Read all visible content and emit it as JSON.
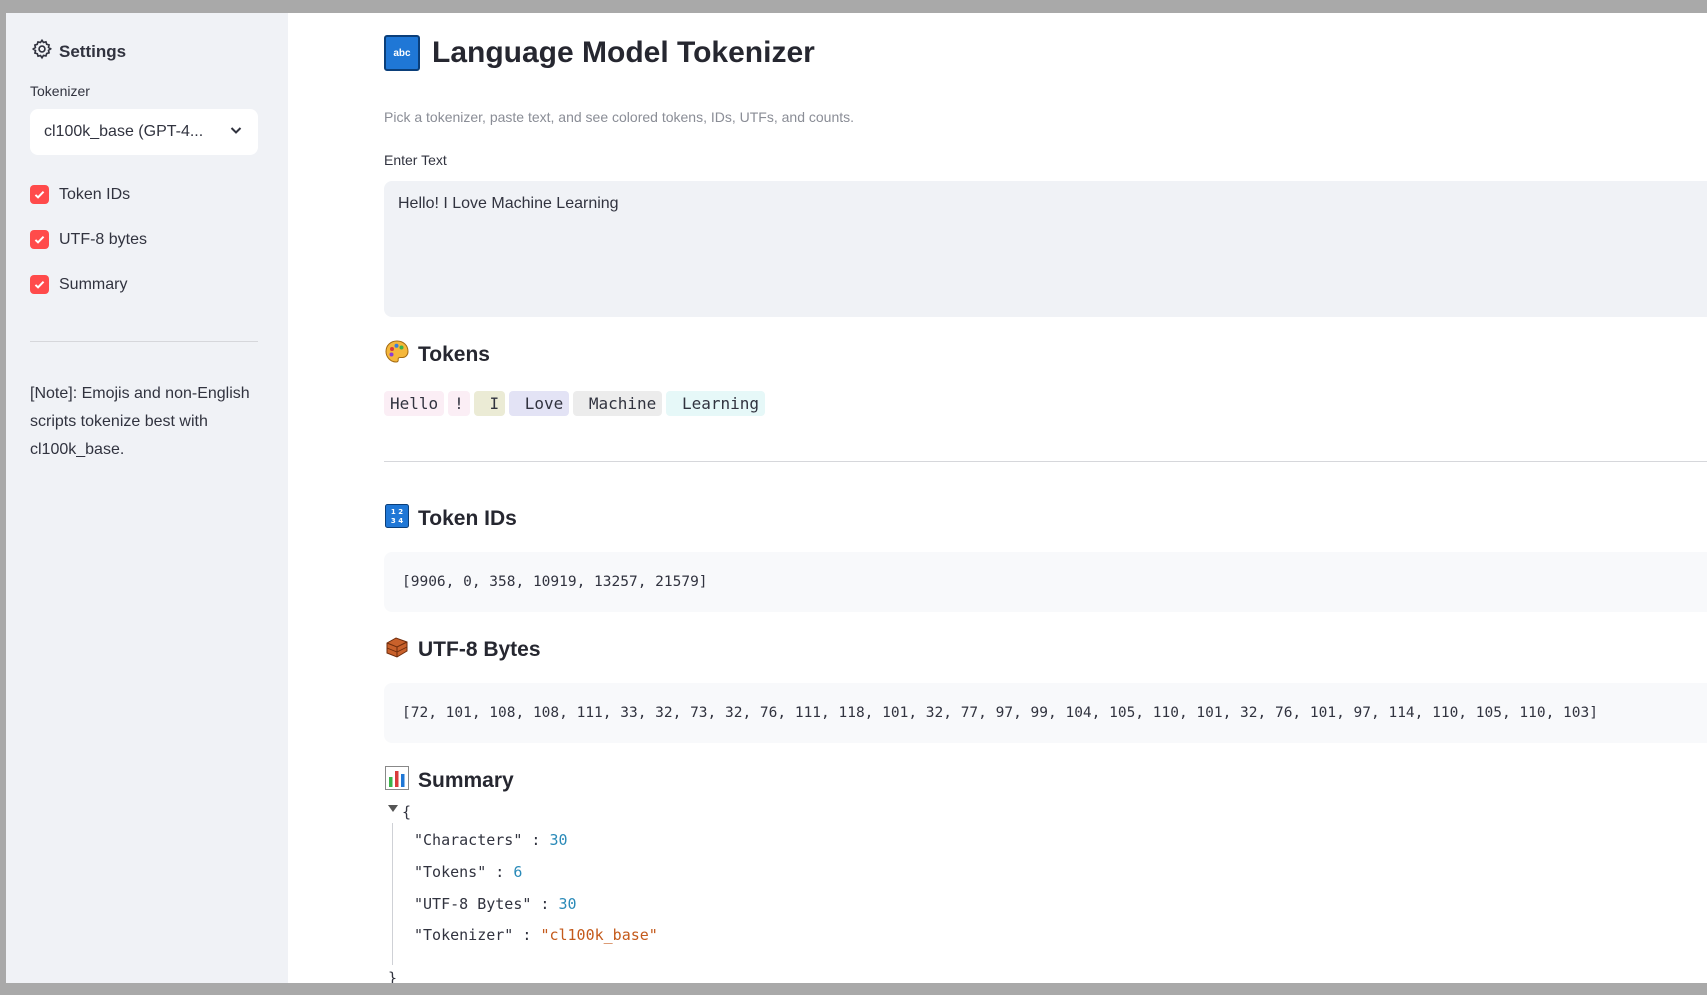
{
  "sidebar": {
    "header": "Settings",
    "tokenizer_label": "Tokenizer",
    "tokenizer_selected": "cl100k_base (GPT-4...",
    "checkboxes": [
      {
        "label": "Token IDs",
        "checked": true
      },
      {
        "label": "UTF-8 bytes",
        "checked": true
      },
      {
        "label": "Summary",
        "checked": true
      }
    ],
    "note": "[Note]: Emojis and non-English scripts tokenize best with cl100k_base."
  },
  "main": {
    "title": "Language Model Tokenizer",
    "title_icon": "abc",
    "subtitle": "Pick a tokenizer, paste text, and see colored tokens, IDs, UTFs, and counts.",
    "input_label": "Enter Text",
    "input_value": "Hello! I Love Machine Learning",
    "tokens_heading": "Tokens",
    "tokens": [
      {
        "text": "Hello",
        "color": "#fbeef5"
      },
      {
        "text": "!",
        "color": "#fbeef5"
      },
      {
        "text": " I",
        "color": "#ebebd5"
      },
      {
        "text": " Love",
        "color": "#e3e3f5"
      },
      {
        "text": " Machine",
        "color": "#ececec"
      },
      {
        "text": " Learning",
        "color": "#e6f8f8"
      }
    ],
    "token_ids_heading": "Token IDs",
    "token_ids_text": "[9906, 0, 358, 10919, 13257, 21579]",
    "utf8_heading": "UTF-8 Bytes",
    "utf8_text": "[72, 101, 108, 108, 111, 33, 32, 73, 32, 76, 111, 118, 101, 32, 77, 97, 99, 104, 105, 110, 101, 32, 76, 101, 97, 114, 110, 105, 110, 103]",
    "summary_heading": "Summary",
    "summary": {
      "open_brace": "{",
      "close_brace": "}",
      "rows": [
        {
          "key": "\"Characters\"",
          "value": "30",
          "type": "num"
        },
        {
          "key": "\"Tokens\"",
          "value": "6",
          "type": "num"
        },
        {
          "key": "\"UTF-8 Bytes\"",
          "value": "30",
          "type": "num"
        },
        {
          "key": "\"Tokenizer\"",
          "value": "\"cl100k_base\"",
          "type": "str"
        }
      ]
    }
  },
  "colors": {
    "accent": "#ff4b4b",
    "sidebar_bg": "#f0f2f6",
    "json_number": "#2a8ab8",
    "json_string": "#c45a1b"
  },
  "icons": {
    "settings": "gear-icon",
    "select": "chevron-down-icon",
    "tokens": "palette-icon",
    "token_ids": "numbers-icon",
    "utf8": "bricks-icon",
    "summary": "bar-chart-icon"
  }
}
